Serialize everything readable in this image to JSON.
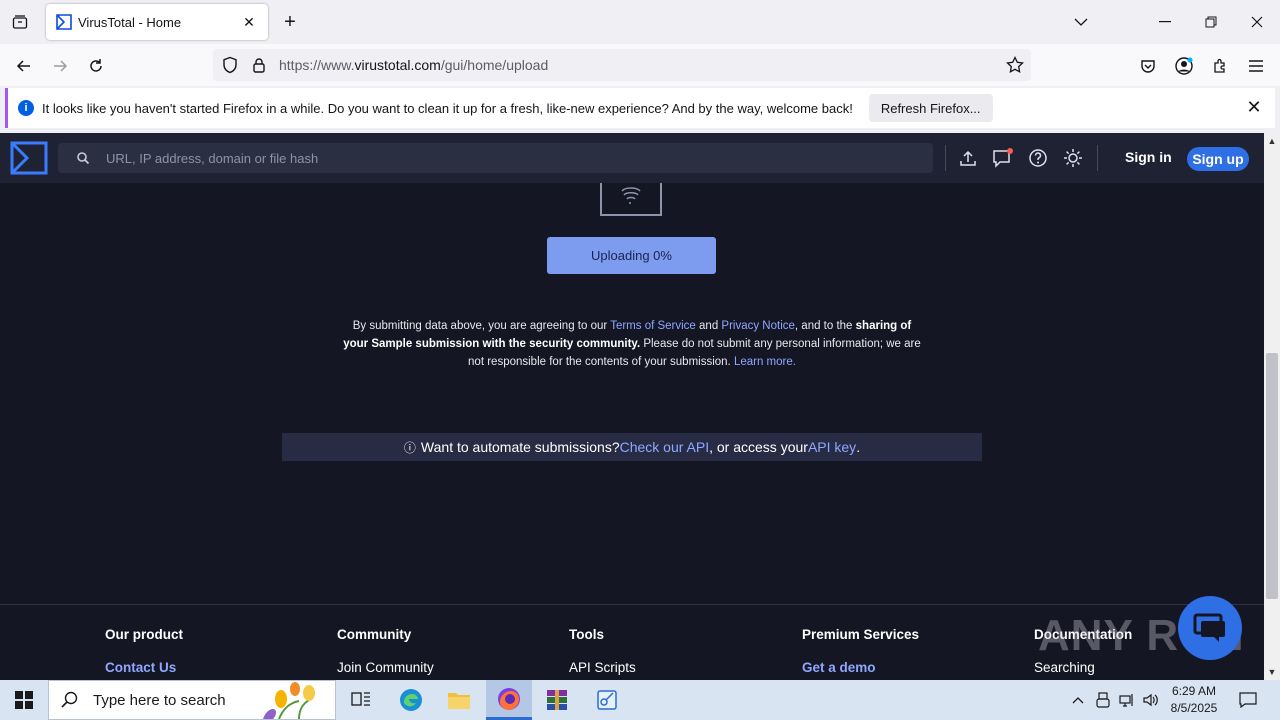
{
  "browser": {
    "tab_title": "VirusTotal - Home",
    "url_prefix": "https://www.",
    "url_domain": "virustotal.com",
    "url_path": "/gui/home/upload"
  },
  "notification": {
    "message": "It looks like you haven't started Firefox in a while. Do you want to clean it up for a fresh, like-new experience? And by the way, welcome back!",
    "refresh_label": "Refresh Firefox..."
  },
  "vt": {
    "search_placeholder": "URL, IP address, domain or file hash",
    "sign_in": "Sign in",
    "sign_up": "Sign up",
    "upload_status": "Uploading 0%",
    "terms": {
      "t1": "By submitting data above, you are agreeing to our ",
      "tos": "Terms of Service",
      "t2": " and ",
      "privacy": "Privacy Notice",
      "t3": ", and to the ",
      "sharing": "sharing of your Sample submission with the security community.",
      "t4": " Please do not submit any personal information; we are not responsible for the contents of your submission. ",
      "learn": "Learn more."
    },
    "api": {
      "t1": "Want to automate submissions? ",
      "check_api": "Check our API",
      "t2": ", or access your ",
      "api_key": "API key",
      "t3": "."
    },
    "footer": [
      {
        "head": "Our product",
        "item": "Contact Us"
      },
      {
        "head": "Community",
        "item": "Join Community"
      },
      {
        "head": "Tools",
        "item": "API Scripts"
      },
      {
        "head": "Premium Services",
        "item": "Get a demo"
      },
      {
        "head": "Documentation",
        "item": "Searching"
      }
    ]
  },
  "watermark": "ANY RUN",
  "taskbar": {
    "search_placeholder": "Type here to search",
    "time": "6:29 AM",
    "date": "8/5/2025"
  },
  "colors": {
    "page_bg": "#151623",
    "header_bg": "#1f2233",
    "accent": "#2f6fe6",
    "link": "#8fa7ff",
    "upload_button": "#7d9cf0"
  }
}
